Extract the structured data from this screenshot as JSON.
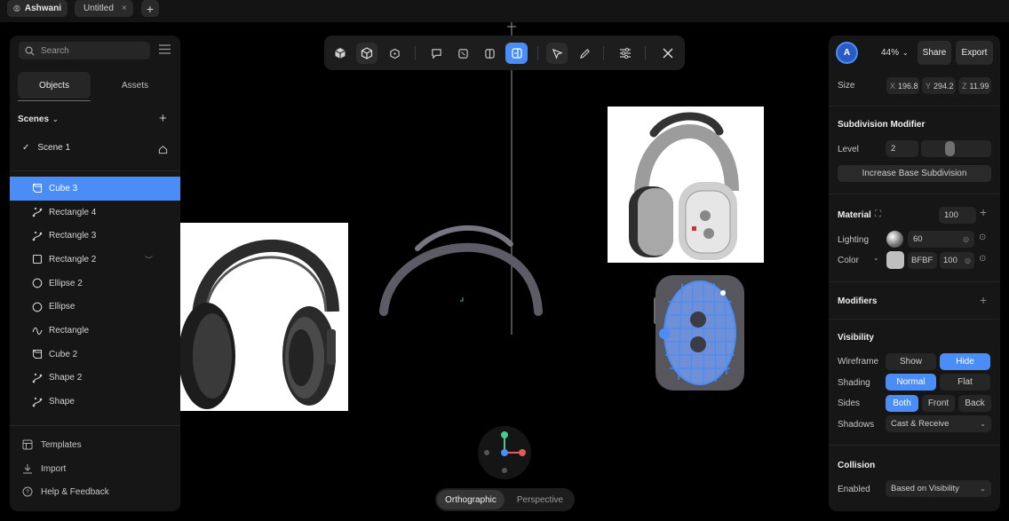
{
  "tabs": [
    {
      "label": "Ashwani"
    },
    {
      "label": "Untitled"
    }
  ],
  "left": {
    "search_placeholder": "Search",
    "segments": [
      "Objects",
      "Assets"
    ],
    "scenes_label": "Scenes",
    "scene": "Scene 1",
    "layers": [
      {
        "label": "Cube 3",
        "icon": "cube-icon"
      },
      {
        "label": "Rectangle 4",
        "icon": "path-icon"
      },
      {
        "label": "Rectangle 3",
        "icon": "path-icon"
      },
      {
        "label": "Rectangle 2",
        "icon": "square-icon"
      },
      {
        "label": "Ellipse 2",
        "icon": "circle-icon"
      },
      {
        "label": "Ellipse",
        "icon": "circle-icon"
      },
      {
        "label": "Rectangle",
        "icon": "wave-icon"
      },
      {
        "label": "Cube 2",
        "icon": "cube-icon"
      },
      {
        "label": "Shape 2",
        "icon": "path-icon"
      },
      {
        "label": "Shape",
        "icon": "path-icon"
      }
    ],
    "footer": [
      "Templates",
      "Import",
      "Help & Feedback"
    ]
  },
  "right": {
    "avatar": "A",
    "zoom": "44%",
    "share": "Share",
    "export": "Export",
    "size_label": "Size",
    "size": {
      "x": "196.8",
      "y": "294.2",
      "z": "11.99"
    },
    "subdiv_title": "Subdivision Modifier",
    "level_label": "Level",
    "level_value": "2",
    "increase_btn": "Increase Base Subdivision",
    "material_title": "Material",
    "material_value": "100",
    "lighting_label": "Lighting",
    "lighting_value": "60",
    "color_label": "Color",
    "color_hex": "BFBF",
    "color_opacity": "100",
    "modifiers_title": "Modifiers",
    "visibility_title": "Visibility",
    "wireframe_label": "Wireframe",
    "wireframe_opts": [
      "Show",
      "Hide"
    ],
    "shading_label": "Shading",
    "shading_opts": [
      "Normal",
      "Flat"
    ],
    "sides_label": "Sides",
    "sides_opts": [
      "Both",
      "Front",
      "Back"
    ],
    "shadows_label": "Shadows",
    "shadows_value": "Cast & Receive",
    "collision_title": "Collision",
    "enabled_label": "Enabled",
    "enabled_value": "Based on Visibility"
  },
  "view": {
    "modes": [
      "Orthographic",
      "Perspective"
    ]
  },
  "colors": {
    "accent": "#4a8df7",
    "panel": "#161616",
    "bg": "#000000"
  }
}
